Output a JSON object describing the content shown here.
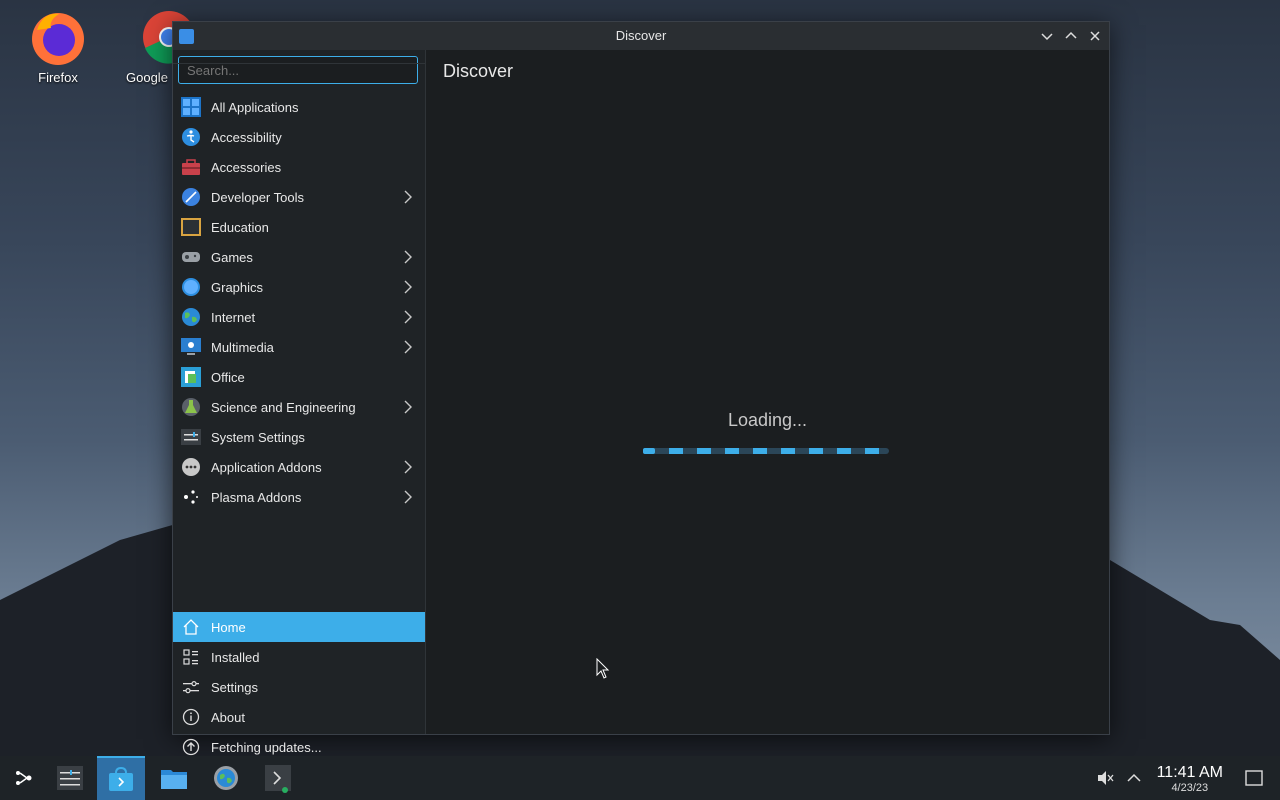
{
  "desktop": {
    "icons": [
      {
        "label": "Firefox",
        "icon": "firefox-icon"
      },
      {
        "label": "Google",
        "icon": "chrome-icon"
      }
    ]
  },
  "window": {
    "title": "Discover",
    "search_placeholder": "Search...",
    "page_title": "Discover",
    "loading_text": "Loading...",
    "categories": [
      {
        "label": "All Applications",
        "icon": "grid-icon",
        "submenu": false
      },
      {
        "label": "Accessibility",
        "icon": "accessibility-icon",
        "submenu": false
      },
      {
        "label": "Accessories",
        "icon": "toolbox-icon",
        "submenu": false
      },
      {
        "label": "Developer Tools",
        "icon": "developer-tools-icon",
        "submenu": true
      },
      {
        "label": "Education",
        "icon": "chalkboard-icon",
        "submenu": false
      },
      {
        "label": "Games",
        "icon": "gamepad-icon",
        "submenu": true
      },
      {
        "label": "Graphics",
        "icon": "graphics-icon",
        "submenu": true
      },
      {
        "label": "Internet",
        "icon": "globe-icon",
        "submenu": true
      },
      {
        "label": "Multimedia",
        "icon": "monitor-icon",
        "submenu": true
      },
      {
        "label": "Office",
        "icon": "office-icon",
        "submenu": false
      },
      {
        "label": "Science and Engineering",
        "icon": "flask-icon",
        "submenu": true
      },
      {
        "label": "System Settings",
        "icon": "sliders-icon",
        "submenu": false
      },
      {
        "label": "Application Addons",
        "icon": "addons-icon",
        "submenu": true
      },
      {
        "label": "Plasma Addons",
        "icon": "plasma-icon",
        "submenu": true
      }
    ],
    "nav": [
      {
        "label": "Home",
        "icon": "home-icon",
        "active": true
      },
      {
        "label": "Installed",
        "icon": "installed-icon",
        "active": false
      },
      {
        "label": "Settings",
        "icon": "settings-icon",
        "active": false
      },
      {
        "label": "About",
        "icon": "info-icon",
        "active": false
      },
      {
        "label": "Fetching updates...",
        "icon": "update-icon",
        "active": false
      }
    ]
  },
  "taskbar": {
    "time": "11:41 AM",
    "date": "4/23/23",
    "items": [
      "app-launcher-icon",
      "task-manager-icon",
      "discover-icon",
      "file-manager-icon",
      "system-settings-icon",
      "konsole-icon"
    ]
  },
  "colors": {
    "accent": "#3daee9",
    "window_bg": "#1b1e20",
    "sidebar_bg": "#1f2326"
  }
}
